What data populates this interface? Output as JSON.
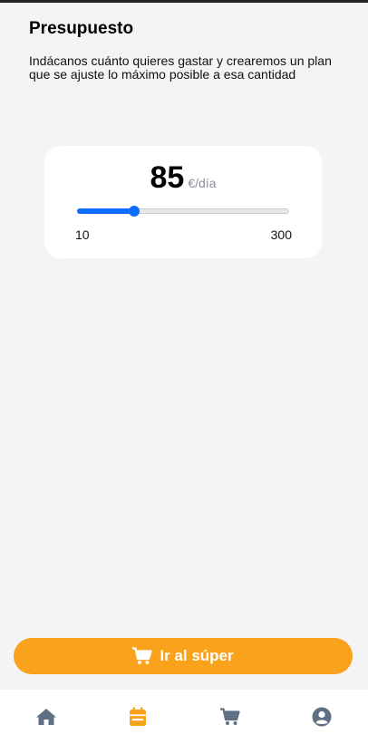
{
  "header": {
    "title": "Presupuesto",
    "subtitle": "Indácanos cuánto quieres gastar y crearemos un plan que se ajuste lo máximo posible a esa cantidad"
  },
  "budget": {
    "value": "85",
    "unit": "€/día",
    "min": "10",
    "max": "300",
    "slider_fraction": 0.27
  },
  "cta": {
    "label": "Ir al súper",
    "icon": "cart-icon"
  },
  "bottom_nav": {
    "items": [
      {
        "icon": "home-icon",
        "active": false
      },
      {
        "icon": "calendar-icon",
        "active": true
      },
      {
        "icon": "cart-icon",
        "active": false
      },
      {
        "icon": "user-icon",
        "active": false
      }
    ]
  },
  "colors": {
    "accent": "#faa21b",
    "slider": "#0d6efd",
    "nav_inactive": "#5f6f84",
    "background": "#f3f4f6"
  }
}
